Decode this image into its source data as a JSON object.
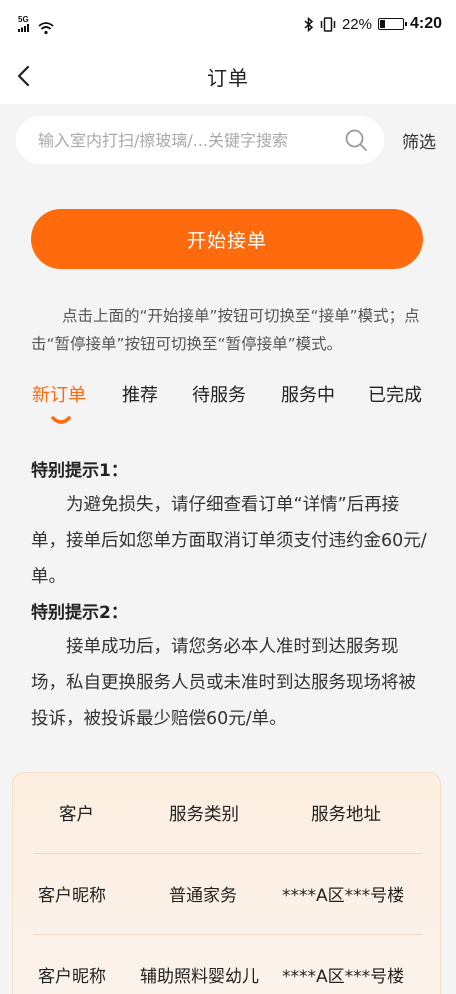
{
  "status_bar": {
    "network": "5G",
    "battery_percent": "22%",
    "battery_level": 0.22,
    "time": "4:20"
  },
  "header": {
    "title": "订单"
  },
  "search": {
    "placeholder": "输入室内打扫/擦玻璃/...关键字搜索",
    "filter_label": "筛选"
  },
  "start_button": {
    "label": "开始接单"
  },
  "hint_text": "点击上面的“开始接单”按钮可切换至“接单”模式；点击“暂停接单”按钮可切换至“暂停接单”模式。",
  "tabs": [
    {
      "label": "新订单",
      "active": true
    },
    {
      "label": "推荐",
      "active": false
    },
    {
      "label": "待服务",
      "active": false
    },
    {
      "label": "服务中",
      "active": false
    },
    {
      "label": "已完成",
      "active": false
    }
  ],
  "notices": [
    {
      "title": "特别提示1：",
      "body": "为避免损失，请仔细查看订单“详情”后再接单，接单后如您单方面取消订单须支付违约金60元/单。"
    },
    {
      "title": "特别提示2：",
      "body": "接单成功后，请您务必本人准时到达服务现场，私自更换服务人员或未准时到达服务现场将被投诉，被投诉最少赔偿60元/单。"
    }
  ],
  "table": {
    "headers": [
      "客户",
      "服务类别",
      "服务地址"
    ],
    "rows": [
      [
        "客户昵称",
        "普通家务",
        "****A区***号楼"
      ],
      [
        "客户昵称",
        "辅助照料婴幼儿",
        "****A区***号楼"
      ]
    ]
  },
  "colors": {
    "accent": "#ff6a0d",
    "background": "#f4f4f4"
  }
}
